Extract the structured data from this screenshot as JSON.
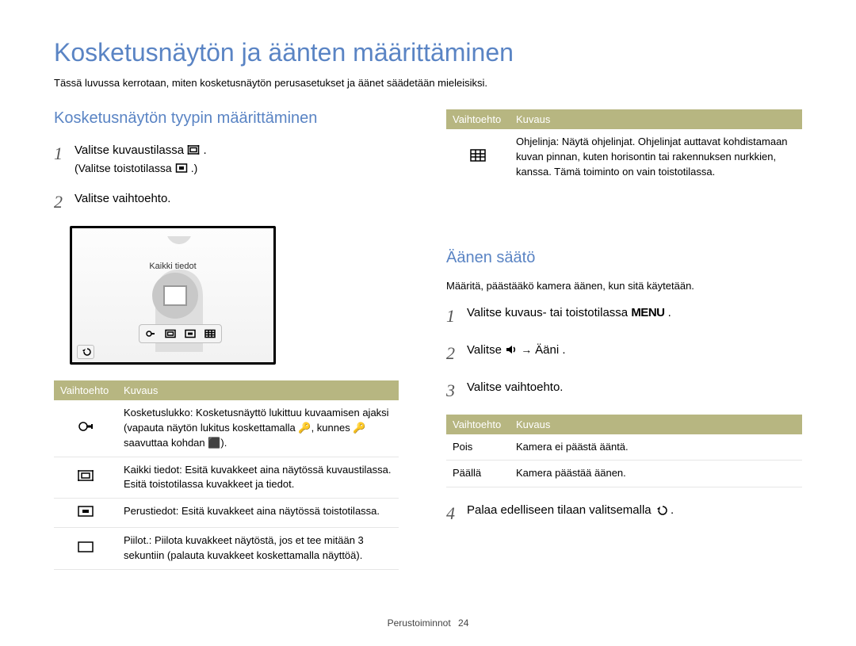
{
  "title": "Kosketusnäytön ja äänten määrittäminen",
  "intro": "Tässä luvussa kerrotaan, miten kosketusnäytön perusasetukset ja äänet säädetään mieleisiksi.",
  "left": {
    "heading": "Kosketusnäytön tyypin määrittäminen",
    "step1a": "Valitse kuvaustilassa ",
    "step1a_icon_after": ".",
    "step1b": "(Valitse toistotilassa ",
    "step1b_icon_after": ".)",
    "step2": "Valitse vaihtoehto.",
    "lcd_label": "Kaikki tiedot",
    "table_head": {
      "opt": "Vaihtoehto",
      "desc": "Kuvaus"
    },
    "rows": [
      {
        "icon": "lock",
        "lead": "Kosketuslukko",
        "body": ": Kosketusnäyttö lukittuu kuvaamisen ajaksi (vapauta näytön lukitus koskettamalla 🔑, kunnes 🔑 saavuttaa kohdan ⬛)."
      },
      {
        "icon": "all",
        "lead": "Kaikki tiedot",
        "body": ": Esitä kuvakkeet aina näytössä kuvaustilassa. Esitä toistotilassa kuvakkeet ja tiedot."
      },
      {
        "icon": "basic",
        "lead": "Perustiedot",
        "body": ": Esitä kuvakkeet aina näytössä toistotilassa."
      },
      {
        "icon": "hide",
        "lead": "Piilot.",
        "body": ": Piilota kuvakkeet näytöstä, jos et tee mitään 3 sekuntiin (palauta kuvakkeet koskettamalla näyttöä)."
      }
    ]
  },
  "right_top": {
    "table_head": {
      "opt": "Vaihtoehto",
      "desc": "Kuvaus"
    },
    "row": {
      "icon": "grid",
      "lead": "Ohjelinja",
      "body": ": Näytä ohjelinjat. Ohjelinjat auttavat kohdistamaan kuvan pinnan, kuten horisontin tai rakennuksen nurkkien, kanssa. Tämä toiminto on vain toistotilassa."
    }
  },
  "right": {
    "heading": "Äänen säätö",
    "intro": "Määritä, päästääkö kamera äänen, kun sitä käytetään.",
    "step1": "Valitse kuvaus- tai toistotilassa ",
    "step1_menu": "MENU",
    "step1_after": ".",
    "step2_a": "Valitse ",
    "step2_arrow": " → ",
    "step2_b": "Ääni",
    "step2_after": ".",
    "step3": "Valitse vaihtoehto.",
    "table_head": {
      "opt": "Vaihtoehto",
      "desc": "Kuvaus"
    },
    "rows": [
      {
        "opt": "Pois",
        "desc": "Kamera ei päästä ääntä."
      },
      {
        "opt": "Päällä",
        "desc": "Kamera päästää äänen."
      }
    ],
    "step4": "Palaa edelliseen tilaan valitsemalla ",
    "step4_after": "."
  },
  "footer": {
    "section": "Perustoiminnot",
    "page": "24"
  }
}
